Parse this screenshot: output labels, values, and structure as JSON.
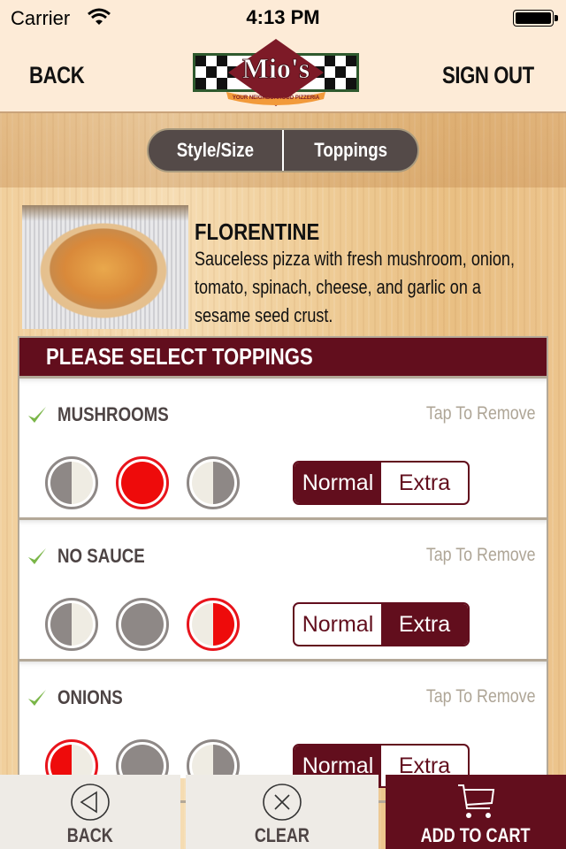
{
  "status_bar": {
    "carrier": "Carrier",
    "time": "4:13 PM",
    "battery_level": 1.0
  },
  "header": {
    "back_label": "BACK",
    "sign_out_label": "SIGN OUT",
    "logo": {
      "brand": "Mio's",
      "tagline": "YOUR NEIGHBORHOOD PIZZERIA"
    }
  },
  "segmented_tabs": {
    "items": [
      {
        "label": "Style/Size",
        "selected": false
      },
      {
        "label": "Toppings",
        "selected": true
      }
    ]
  },
  "item": {
    "name": "FLORENTINE",
    "description": "Sauceless pizza with fresh mushroom, onion, tomato, spinach, cheese, and garlic on a sesame seed crust.",
    "image_alt": "pizza-photo"
  },
  "toppings_panel": {
    "title": "PLEASE SELECT TOPPINGS",
    "remove_label": "Tap To Remove",
    "coverage_options": [
      "left-half",
      "whole",
      "right-half"
    ],
    "amount_options": [
      "Normal",
      "Extra"
    ],
    "rows": [
      {
        "name": "MUSHROOMS",
        "checked": true,
        "coverage": "whole",
        "amount": "Normal"
      },
      {
        "name": "NO SAUCE",
        "checked": true,
        "coverage": "right-half",
        "amount": "Extra"
      },
      {
        "name": "ONIONS",
        "checked": true,
        "coverage": "left-half",
        "amount": "Normal"
      }
    ]
  },
  "footer": {
    "back_label": "BACK",
    "clear_label": "CLEAR",
    "add_to_cart_label": "ADD TO CART"
  },
  "colors": {
    "brand_maroon": "#620e1d",
    "selected_red": "#e8141c",
    "check_green": "#7ab648",
    "header_bg": "#fdebd7",
    "segment_bg": "#544a48"
  }
}
